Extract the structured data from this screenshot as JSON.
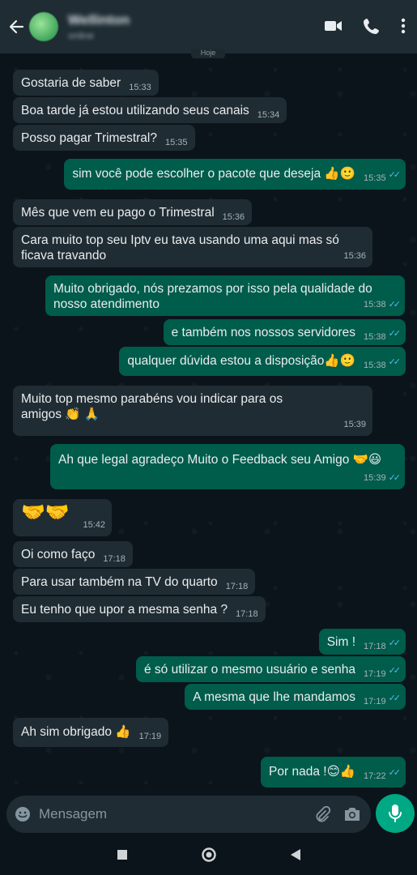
{
  "header": {
    "contact_name": "Wellinton",
    "contact_status": "online"
  },
  "chat": {
    "date_chip": "Hoje",
    "messages": [
      {
        "dir": "in",
        "text": "Gostaria de saber",
        "time": "15:33"
      },
      {
        "dir": "in",
        "text": "Boa tarde já estou utilizando seus canais",
        "time": "15:34"
      },
      {
        "dir": "in",
        "text": "Posso pagar Trimestral?",
        "time": "15:35"
      },
      {
        "dir": "out",
        "text": "sim você pode escolher o pacote que deseja 👍🙂",
        "time": "15:35"
      },
      {
        "dir": "in",
        "text": "Mês que vem eu pago o Trimestral",
        "time": "15:36"
      },
      {
        "dir": "in",
        "text": "Cara muito top seu Iptv  eu tava usando uma aqui mas só ficava travando",
        "time": "15:36"
      },
      {
        "dir": "out",
        "text": "Muito obrigado, nós prezamos por isso pela qualidade do nosso atendimento",
        "time": "15:38"
      },
      {
        "dir": "out",
        "text": "e também nos nossos servidores",
        "time": "15:38"
      },
      {
        "dir": "out",
        "text": "qualquer dúvida estou a disposição👍🙂",
        "time": "15:38"
      },
      {
        "dir": "in",
        "text": "Muito top mesmo parabéns vou indicar para os amigos 👏 🙏",
        "time": "15:39"
      },
      {
        "dir": "out",
        "text": "Ah que legal agradeço Muito o Feedback seu Amigo 🤝😃",
        "time": "15:39"
      },
      {
        "dir": "in",
        "text": "🤝🤝",
        "time": "15:42"
      },
      {
        "dir": "in",
        "text": "Oi como faço",
        "time": "17:18"
      },
      {
        "dir": "in",
        "text": "Para usar também na TV do quarto",
        "time": "17:18"
      },
      {
        "dir": "in",
        "text": "Eu tenho que upor a mesma  senha ?",
        "time": "17:18"
      },
      {
        "dir": "out",
        "text": "Sim !",
        "time": "17:18"
      },
      {
        "dir": "out",
        "text": "é só utilizar o mesmo usuário e senha",
        "time": "17:19"
      },
      {
        "dir": "out",
        "text": "A mesma que lhe mandamos",
        "time": "17:19"
      },
      {
        "dir": "in",
        "text": "Ah sim obrigado 👍",
        "time": "17:19"
      },
      {
        "dir": "out",
        "text": "Por nada !😊👍",
        "time": "17:22"
      }
    ]
  },
  "composer": {
    "placeholder": "Mensagem"
  },
  "icons": {
    "back": "back-arrow-icon",
    "video": "video-call-icon",
    "call": "phone-icon",
    "menu": "more-vertical-icon",
    "emoji": "emoji-icon",
    "attach": "paperclip-icon",
    "camera": "camera-icon",
    "mic": "mic-icon"
  },
  "colors": {
    "background": "#0b141a",
    "header": "#1f2c34",
    "incoming_bubble": "#202c33",
    "outgoing_bubble": "#005c4b",
    "accent": "#00a884",
    "read_tick": "#53bdeb"
  }
}
